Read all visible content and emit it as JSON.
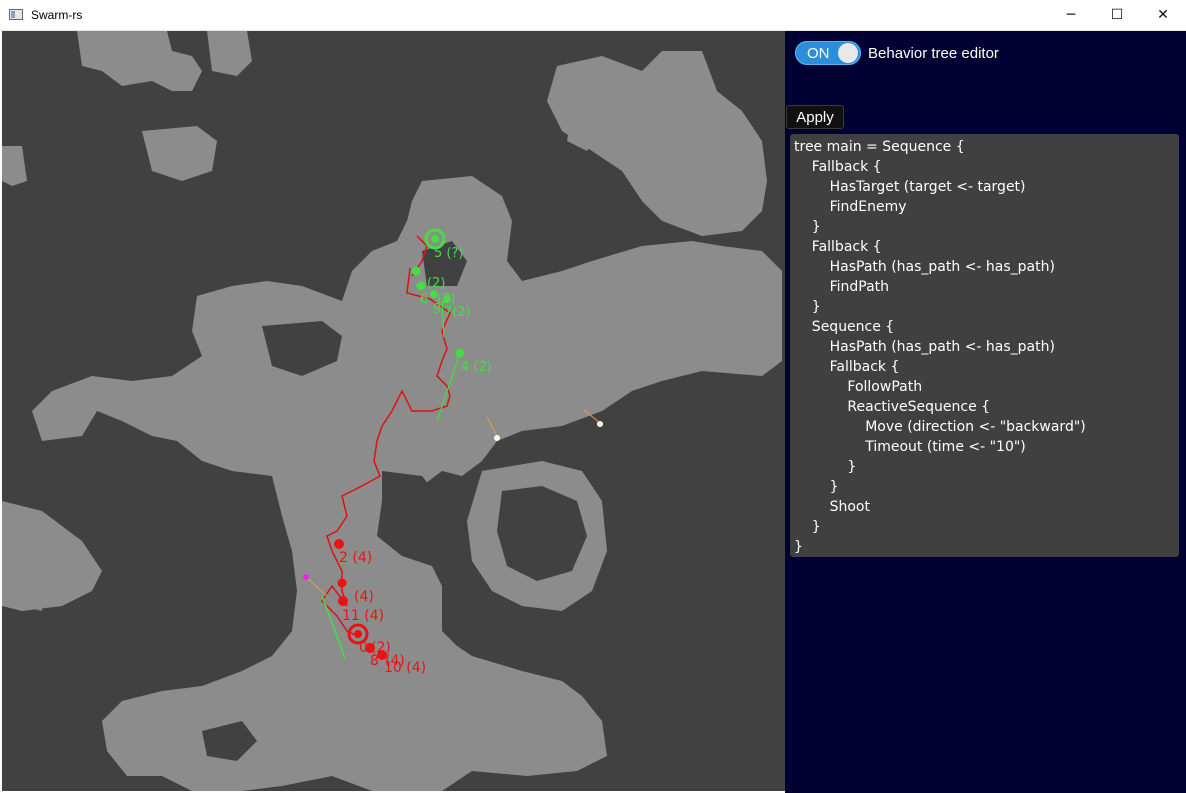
{
  "window": {
    "title": "Swarm-rs",
    "icon": "app-window-icon",
    "controls": {
      "minimize": "─",
      "maximize": "☐",
      "close": "✕"
    }
  },
  "map": {
    "colors": {
      "obstacle": "#414141",
      "free": "#8c8c8c",
      "team_green": "#44dd44",
      "team_red": "#ee1111",
      "path_red": "#dd1111",
      "bullet": "#ffffee",
      "bullet_trail": "#e0a040",
      "pointer": "#ee22ee"
    },
    "agent_labels": {
      "green": [
        "5 (?)",
        "(2)",
        "6",
        "(2)",
        "9",
        "7(2)",
        "4 (2)"
      ],
      "red": [
        "2 (4)",
        "(4)",
        "11 (4)",
        "0",
        "(2)",
        "8",
        "(4)",
        "10 (4)"
      ]
    }
  },
  "panel": {
    "background": "#000033",
    "toggle": {
      "label": "ON",
      "state": "on"
    },
    "toggle_caption": "Behavior tree editor",
    "apply_label": "Apply",
    "editor_text": "tree main = Sequence {\n    Fallback {\n        HasTarget (target <- target)\n        FindEnemy\n    }\n    Fallback {\n        HasPath (has_path <- has_path)\n        FindPath\n    }\n    Sequence {\n        HasPath (has_path <- has_path)\n        Fallback {\n            FollowPath\n            ReactiveSequence {\n                Move (direction <- \"backward\")\n                Timeout (time <- \"10\")\n            }\n        }\n        Shoot\n    }\n}"
  }
}
